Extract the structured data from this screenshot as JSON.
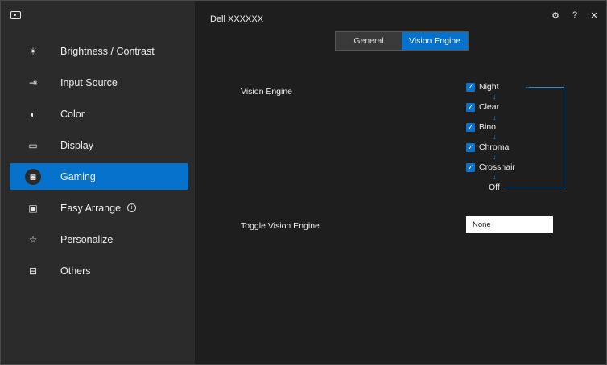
{
  "app": {
    "title": "Dell XXXXXX"
  },
  "sidebar": {
    "items": [
      {
        "label": "Brightness / Contrast",
        "icon": "brightness-icon",
        "active": false
      },
      {
        "label": "Input Source",
        "icon": "input-source-icon",
        "active": false
      },
      {
        "label": "Color",
        "icon": "color-palette-icon",
        "active": false
      },
      {
        "label": "Display",
        "icon": "monitor-icon",
        "active": false
      },
      {
        "label": "Gaming",
        "icon": "gamepad-icon",
        "active": true
      },
      {
        "label": "Easy Arrange",
        "icon": "easy-arrange-icon",
        "active": false,
        "info": "i"
      },
      {
        "label": "Personalize",
        "icon": "star-icon",
        "active": false
      },
      {
        "label": "Others",
        "icon": "others-icon",
        "active": false
      }
    ]
  },
  "header": {
    "icons": [
      "settings-icon",
      "help-icon",
      "close-icon"
    ]
  },
  "tabs": [
    {
      "label": "General",
      "active": false
    },
    {
      "label": "Vision Engine",
      "active": true
    }
  ],
  "vision_engine": {
    "label": "Vision Engine",
    "options": [
      {
        "label": "Night",
        "checked": true
      },
      {
        "label": "Clear",
        "checked": true
      },
      {
        "label": "Bino",
        "checked": true
      },
      {
        "label": "Chroma",
        "checked": true
      },
      {
        "label": "Crosshair",
        "checked": true
      }
    ],
    "off_label": "Off"
  },
  "toggle": {
    "label": "Toggle Vision Engine",
    "value": "None"
  },
  "colors": {
    "accent": "#0672cb",
    "sidebar_bg": "#2b2b2b",
    "main_bg": "#1e1e1e"
  }
}
